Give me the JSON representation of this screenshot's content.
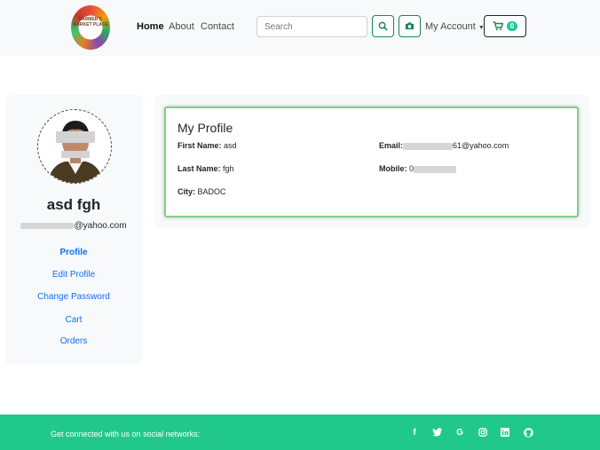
{
  "nav": {
    "logo_text": "FARMER'S MARKET PLACE",
    "links": [
      "Home",
      "About",
      "Contact"
    ],
    "search_placeholder": "Search",
    "account_label": "My Account",
    "cart_count": "0"
  },
  "sidebar": {
    "name": "asd fgh",
    "email_suffix": "@yahoo.com",
    "links": [
      "Profile",
      "Edit Profile",
      "Change Password",
      "Cart",
      "Orders"
    ]
  },
  "profile": {
    "title": "My Profile",
    "first_name_label": "First Name:",
    "first_name": "asd",
    "last_name_label": "Last Name:",
    "last_name": "fgh",
    "city_label": "City:",
    "city": "BADOC",
    "email_label": "Email:",
    "email_suffix": "61@yahoo.com",
    "mobile_label": "Mobile:",
    "mobile_prefix": "0"
  },
  "footer": {
    "text": "Get connected with us on social networks:",
    "social_icons": [
      "facebook-icon",
      "twitter-icon",
      "google-icon",
      "instagram-icon",
      "linkedin-icon",
      "github-icon"
    ]
  },
  "colors": {
    "accent_green": "#20c98b",
    "link_blue": "#0d6efd",
    "button_green": "#198754"
  }
}
